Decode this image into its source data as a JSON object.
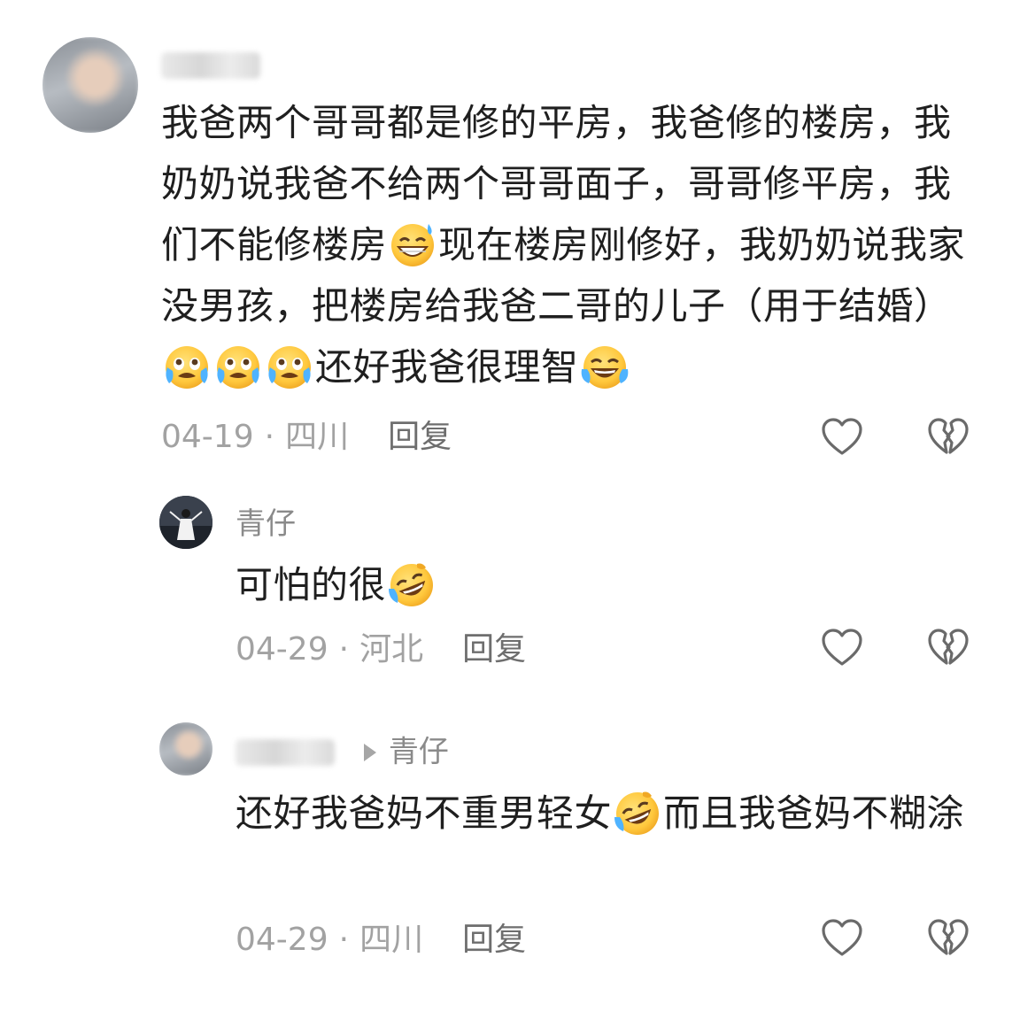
{
  "comments": [
    {
      "username": "",
      "text_parts": [
        "我爸两个哥哥都是修的平房，我爸修的楼房，我奶奶说我爸不给两个哥哥面子，哥哥修平房，我们不能修楼房",
        "现在楼房刚修好，我奶奶说我家没男孩，把楼房给我爸二哥的儿子（用于结婚）",
        "还好我爸很理智"
      ],
      "emojis": [
        "grinning-sweat-emoji",
        "crying-emoji",
        "crying-emoji",
        "crying-emoji",
        "tears-of-joy-emoji"
      ],
      "date": "04-19",
      "separator": "·",
      "location": "四川",
      "reply_label": "回复"
    },
    {
      "username": "青仔",
      "text": "可怕的很",
      "emojis": [
        "rolling-laughing-emoji"
      ],
      "date": "04-29",
      "separator": "·",
      "location": "河北",
      "reply_label": "回复"
    },
    {
      "username": "",
      "reply_to": "青仔",
      "text_parts": [
        "还好我爸妈不重男轻女",
        "而且我爸妈不糊涂"
      ],
      "emojis": [
        "rolling-laughing-emoji"
      ],
      "date": "04-29",
      "separator": "·",
      "location": "四川",
      "reply_label": "回复"
    }
  ],
  "icons": {
    "like": "heart-outline-icon",
    "dislike": "broken-heart-icon"
  },
  "colors": {
    "text": "#1f1f1f",
    "meta": "#a2a2a2",
    "reply": "#6e6e6e",
    "emoji": "#ffc83d"
  }
}
